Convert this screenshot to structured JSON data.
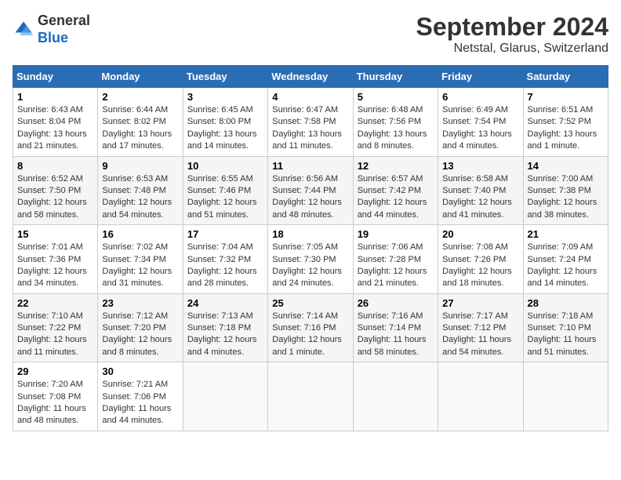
{
  "header": {
    "logo_general": "General",
    "logo_blue": "Blue",
    "month_title": "September 2024",
    "location": "Netstal, Glarus, Switzerland"
  },
  "weekdays": [
    "Sunday",
    "Monday",
    "Tuesday",
    "Wednesday",
    "Thursday",
    "Friday",
    "Saturday"
  ],
  "weeks": [
    [
      {
        "day": "1",
        "info": "Sunrise: 6:43 AM\nSunset: 8:04 PM\nDaylight: 13 hours\nand 21 minutes."
      },
      {
        "day": "2",
        "info": "Sunrise: 6:44 AM\nSunset: 8:02 PM\nDaylight: 13 hours\nand 17 minutes."
      },
      {
        "day": "3",
        "info": "Sunrise: 6:45 AM\nSunset: 8:00 PM\nDaylight: 13 hours\nand 14 minutes."
      },
      {
        "day": "4",
        "info": "Sunrise: 6:47 AM\nSunset: 7:58 PM\nDaylight: 13 hours\nand 11 minutes."
      },
      {
        "day": "5",
        "info": "Sunrise: 6:48 AM\nSunset: 7:56 PM\nDaylight: 13 hours\nand 8 minutes."
      },
      {
        "day": "6",
        "info": "Sunrise: 6:49 AM\nSunset: 7:54 PM\nDaylight: 13 hours\nand 4 minutes."
      },
      {
        "day": "7",
        "info": "Sunrise: 6:51 AM\nSunset: 7:52 PM\nDaylight: 13 hours\nand 1 minute."
      }
    ],
    [
      {
        "day": "8",
        "info": "Sunrise: 6:52 AM\nSunset: 7:50 PM\nDaylight: 12 hours\nand 58 minutes."
      },
      {
        "day": "9",
        "info": "Sunrise: 6:53 AM\nSunset: 7:48 PM\nDaylight: 12 hours\nand 54 minutes."
      },
      {
        "day": "10",
        "info": "Sunrise: 6:55 AM\nSunset: 7:46 PM\nDaylight: 12 hours\nand 51 minutes."
      },
      {
        "day": "11",
        "info": "Sunrise: 6:56 AM\nSunset: 7:44 PM\nDaylight: 12 hours\nand 48 minutes."
      },
      {
        "day": "12",
        "info": "Sunrise: 6:57 AM\nSunset: 7:42 PM\nDaylight: 12 hours\nand 44 minutes."
      },
      {
        "day": "13",
        "info": "Sunrise: 6:58 AM\nSunset: 7:40 PM\nDaylight: 12 hours\nand 41 minutes."
      },
      {
        "day": "14",
        "info": "Sunrise: 7:00 AM\nSunset: 7:38 PM\nDaylight: 12 hours\nand 38 minutes."
      }
    ],
    [
      {
        "day": "15",
        "info": "Sunrise: 7:01 AM\nSunset: 7:36 PM\nDaylight: 12 hours\nand 34 minutes."
      },
      {
        "day": "16",
        "info": "Sunrise: 7:02 AM\nSunset: 7:34 PM\nDaylight: 12 hours\nand 31 minutes."
      },
      {
        "day": "17",
        "info": "Sunrise: 7:04 AM\nSunset: 7:32 PM\nDaylight: 12 hours\nand 28 minutes."
      },
      {
        "day": "18",
        "info": "Sunrise: 7:05 AM\nSunset: 7:30 PM\nDaylight: 12 hours\nand 24 minutes."
      },
      {
        "day": "19",
        "info": "Sunrise: 7:06 AM\nSunset: 7:28 PM\nDaylight: 12 hours\nand 21 minutes."
      },
      {
        "day": "20",
        "info": "Sunrise: 7:08 AM\nSunset: 7:26 PM\nDaylight: 12 hours\nand 18 minutes."
      },
      {
        "day": "21",
        "info": "Sunrise: 7:09 AM\nSunset: 7:24 PM\nDaylight: 12 hours\nand 14 minutes."
      }
    ],
    [
      {
        "day": "22",
        "info": "Sunrise: 7:10 AM\nSunset: 7:22 PM\nDaylight: 12 hours\nand 11 minutes."
      },
      {
        "day": "23",
        "info": "Sunrise: 7:12 AM\nSunset: 7:20 PM\nDaylight: 12 hours\nand 8 minutes."
      },
      {
        "day": "24",
        "info": "Sunrise: 7:13 AM\nSunset: 7:18 PM\nDaylight: 12 hours\nand 4 minutes."
      },
      {
        "day": "25",
        "info": "Sunrise: 7:14 AM\nSunset: 7:16 PM\nDaylight: 12 hours\nand 1 minute."
      },
      {
        "day": "26",
        "info": "Sunrise: 7:16 AM\nSunset: 7:14 PM\nDaylight: 11 hours\nand 58 minutes."
      },
      {
        "day": "27",
        "info": "Sunrise: 7:17 AM\nSunset: 7:12 PM\nDaylight: 11 hours\nand 54 minutes."
      },
      {
        "day": "28",
        "info": "Sunrise: 7:18 AM\nSunset: 7:10 PM\nDaylight: 11 hours\nand 51 minutes."
      }
    ],
    [
      {
        "day": "29",
        "info": "Sunrise: 7:20 AM\nSunset: 7:08 PM\nDaylight: 11 hours\nand 48 minutes."
      },
      {
        "day": "30",
        "info": "Sunrise: 7:21 AM\nSunset: 7:06 PM\nDaylight: 11 hours\nand 44 minutes."
      },
      {
        "day": "",
        "info": ""
      },
      {
        "day": "",
        "info": ""
      },
      {
        "day": "",
        "info": ""
      },
      {
        "day": "",
        "info": ""
      },
      {
        "day": "",
        "info": ""
      }
    ]
  ]
}
